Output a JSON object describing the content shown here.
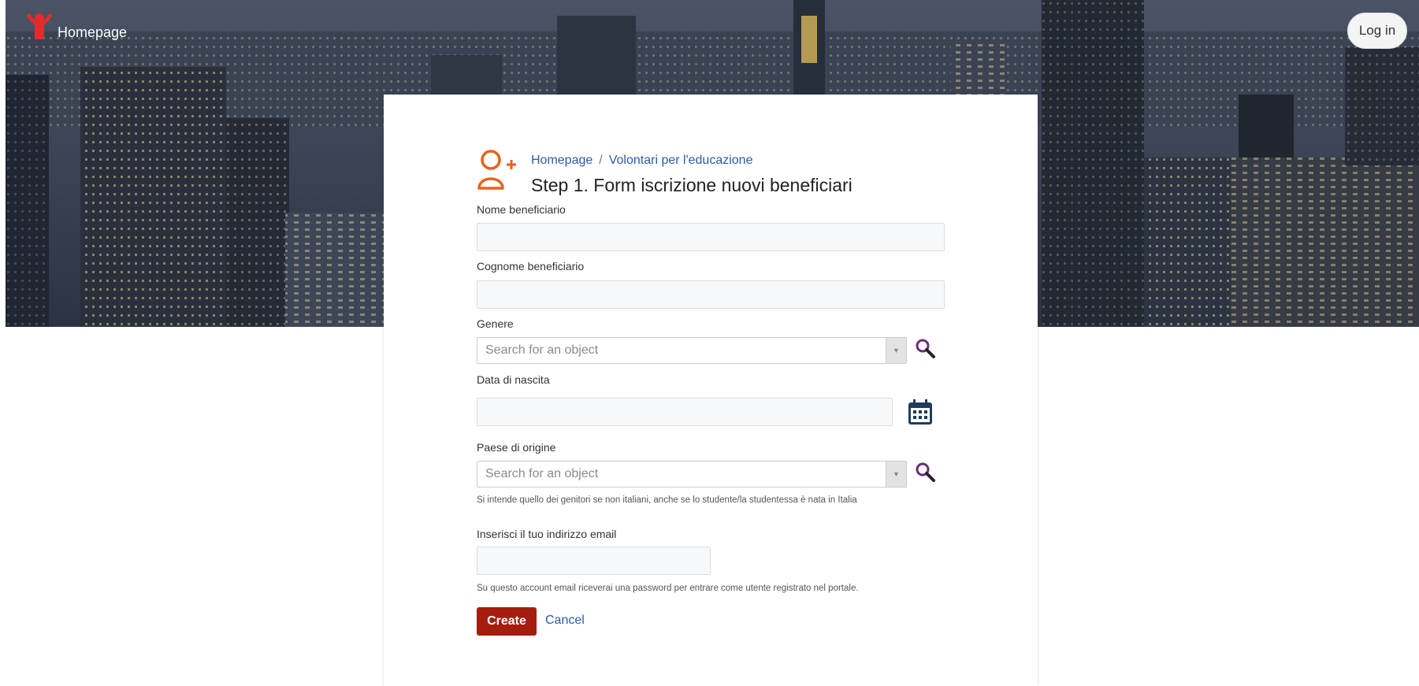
{
  "topbar": {
    "brand_label": "Homepage",
    "login_label": "Log in",
    "logo_icon": "child-hands-up-logo-icon"
  },
  "breadcrumb": {
    "home": "Homepage",
    "separator": "/",
    "current": "Volontari per l'educazione"
  },
  "header": {
    "icon": "user-add-icon",
    "title": "Step 1. Form iscrizione nuovi beneficiari"
  },
  "form": {
    "nome": {
      "label": "Nome beneficiario",
      "value": ""
    },
    "cognome": {
      "label": "Cognome beneficiario",
      "value": ""
    },
    "genere": {
      "label": "Genere",
      "placeholder": "Search for an object"
    },
    "data_nascita": {
      "label": "Data di nascita",
      "value": ""
    },
    "paese": {
      "label": "Paese di origine",
      "placeholder": "Search for an object",
      "help": "Si intende quello dei genitori se non italiani, anche se lo studente/la studentessa è nata in Italia"
    },
    "email": {
      "label": "Inserisci il tuo indirizzo email",
      "value": "",
      "help": "Su questo account email riceverai una password per entrare come utente registrato nel portale."
    }
  },
  "actions": {
    "create_label": "Create",
    "cancel_label": "Cancel"
  },
  "colors": {
    "accent_orange": "#e8621a",
    "primary_button": "#a61d10",
    "link": "#2a5ba8",
    "search_icon": "#6a2c7a",
    "calendar_icon": "#1f3b5c"
  }
}
